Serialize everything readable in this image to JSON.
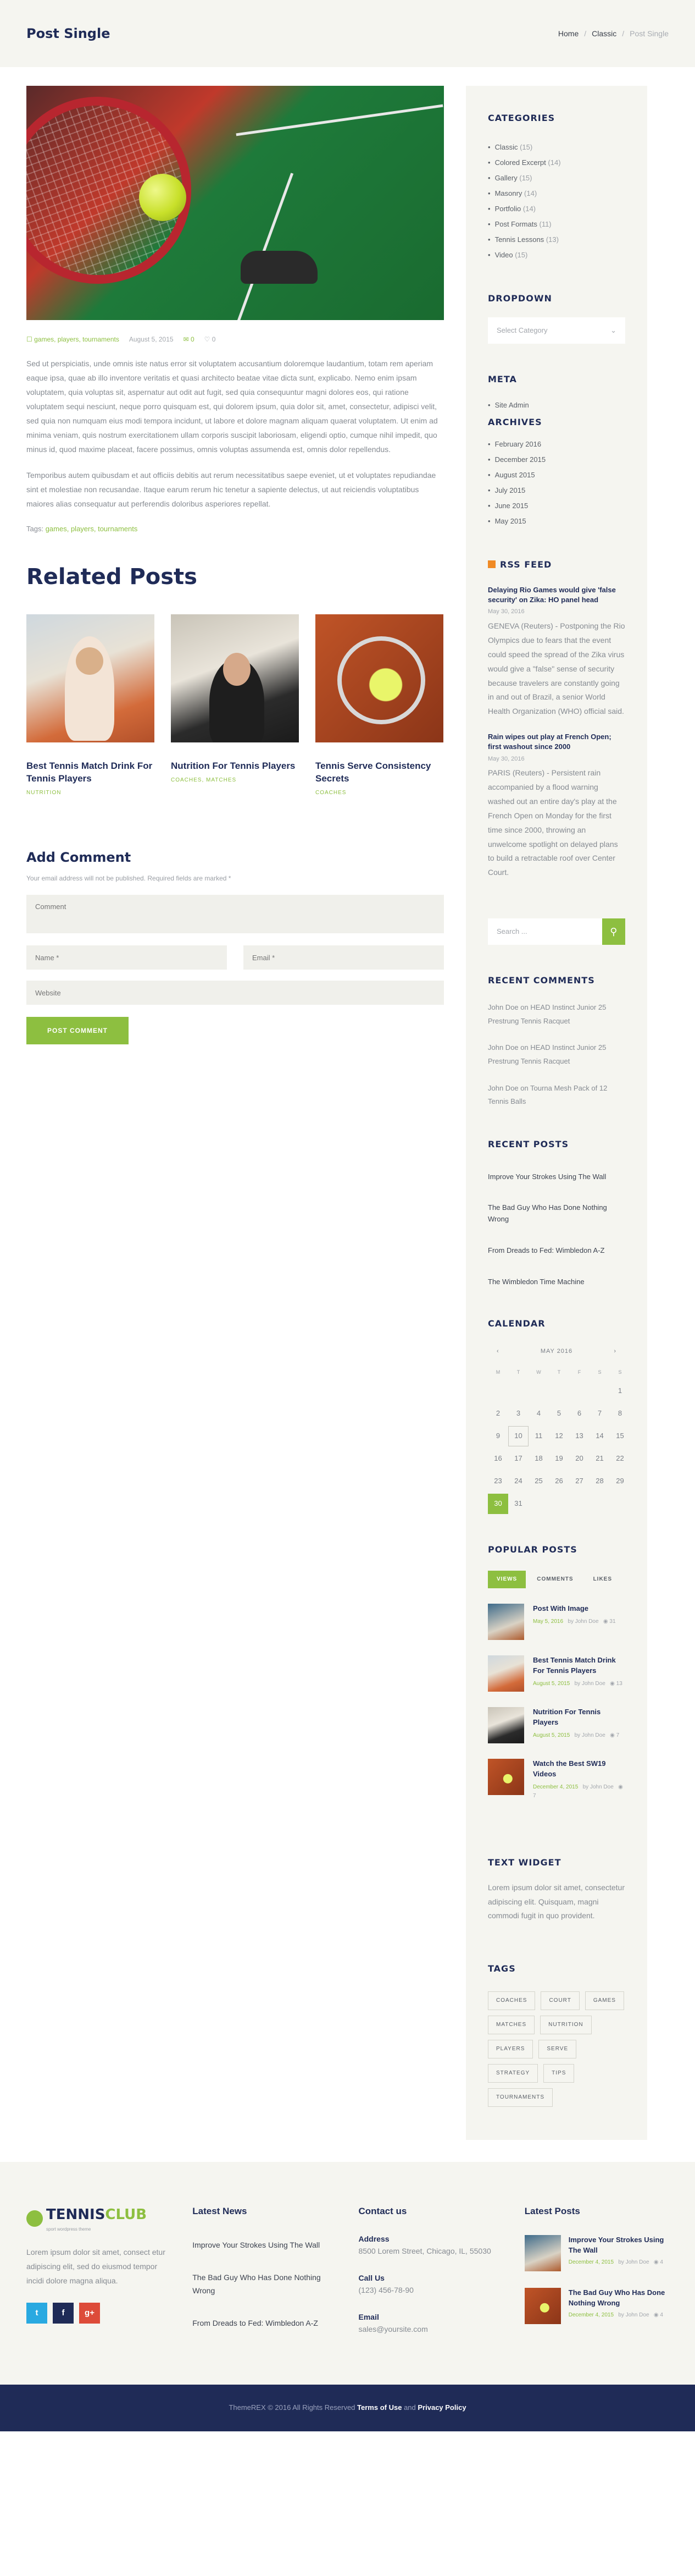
{
  "header": {
    "title": "Post Single",
    "breadcrumb": [
      "Home",
      "Classic",
      "Post Single"
    ]
  },
  "post": {
    "categories": "games, players, tournaments",
    "date": "August 5, 2015",
    "comments_count": "0",
    "likes_count": "0",
    "paragraph1": "Sed ut perspiciatis, unde omnis iste natus error sit voluptatem accusantium doloremque laudantium, totam rem aperiam eaque ipsa, quae ab illo inventore veritatis et quasi architecto beatae vitae dicta sunt, explicabo. Nemo enim ipsam voluptatem, quia voluptas sit, aspernatur aut odit aut fugit, sed quia consequuntur magni dolores eos, qui ratione voluptatem sequi nesciunt, neque porro quisquam est, qui dolorem ipsum, quia dolor sit, amet, consectetur, adipisci velit, sed quia non numquam eius modi tempora incidunt, ut labore et dolore magnam aliquam quaerat voluptatem. Ut enim ad minima veniam, quis nostrum exercitationem ullam corporis suscipit laboriosam, eligendi optio, cumque nihil impedit, quo minus id, quod maxime placeat, facere possimus, omnis voluptas assumenda est, omnis dolor repellendus.",
    "paragraph2": "Temporibus autem quibusdam et aut officiis debitis aut rerum necessitatibus saepe eveniet, ut et voluptates repudiandae sint et molestiae non recusandae. Itaque earum rerum hic tenetur a sapiente delectus, ut aut reiciendis voluptatibus maiores alias consequatur aut perferendis doloribus asperiores repellat.",
    "tags_label": "Tags:",
    "tags": "games, players, tournaments"
  },
  "related": {
    "heading": "Related Posts",
    "items": [
      {
        "title": "Best Tennis Match Drink For Tennis Players",
        "cats": "NUTRITION"
      },
      {
        "title": "Nutrition For Tennis Players",
        "cats": "COACHES, MATCHES"
      },
      {
        "title": "Tennis Serve Consistency Secrets",
        "cats": "COACHES"
      }
    ]
  },
  "comment_form": {
    "heading": "Add Comment",
    "note": "Your email address will not be published. Required fields are marked *",
    "comment_placeholder": "Comment",
    "name_placeholder": "Name *",
    "email_placeholder": "Email *",
    "website_placeholder": "Website",
    "submit_label": "POST COMMENT"
  },
  "sidebar": {
    "categories_title": "CATEGORIES",
    "categories": [
      {
        "label": "Classic",
        "count": "(15)"
      },
      {
        "label": "Colored Excerpt",
        "count": "(14)"
      },
      {
        "label": "Gallery",
        "count": "(15)"
      },
      {
        "label": "Masonry",
        "count": "(14)"
      },
      {
        "label": "Portfolio",
        "count": "(14)"
      },
      {
        "label": "Post Formats",
        "count": "(11)"
      },
      {
        "label": "Tennis Lessons",
        "count": "(13)"
      },
      {
        "label": "Video",
        "count": "(15)"
      }
    ],
    "dropdown_title": "DROPDOWN",
    "dropdown_value": "Select Category",
    "meta_title": "META",
    "meta_link": "Site Admin",
    "archives_title": "ARCHIVES",
    "archives": [
      "February 2016",
      "December 2015",
      "August 2015",
      "July 2015",
      "June 2015",
      "May 2015"
    ],
    "rss_title": "RSS FEED",
    "rss": [
      {
        "title": "Delaying Rio Games would give 'false security' on Zika: HO panel head",
        "date": "May 30, 2016",
        "body": "GENEVA (Reuters) - Postponing the Rio Olympics due to fears that the event could speed the spread of the Zika virus would give a \"false\" sense of security because travelers are constantly going in and out of Brazil, a senior World Health Organization (WHO) official said."
      },
      {
        "title": "Rain wipes out play at French Open; first washout since 2000",
        "date": "May 30, 2016",
        "body": "PARIS (Reuters) - Persistent rain accompanied by a flood warning washed out an entire day's play at the French Open on Monday for the first time since 2000, throwing an unwelcome spotlight on delayed plans to build a retractable roof over Center Court."
      }
    ],
    "search_placeholder": "Search ...",
    "recent_comments_title": "RECENT COMMENTS",
    "recent_comments": [
      {
        "author": "John Doe",
        "on": "on",
        "post": "HEAD Instinct Junior 25 Prestrung Tennis Racquet"
      },
      {
        "author": "John Doe",
        "on": "on",
        "post": "HEAD Instinct Junior 25 Prestrung Tennis Racquet"
      },
      {
        "author": "John Doe",
        "on": "on",
        "post": "Tourna Mesh Pack of 12 Tennis Balls"
      }
    ],
    "recent_posts_title": "RECENT POSTS",
    "recent_posts": [
      "Improve Your Strokes Using The Wall",
      "The Bad Guy Who Has Done Nothing Wrong",
      "From Dreads to Fed: Wimbledon A-Z",
      "The Wimbledon Time Machine"
    ],
    "calendar_title": "CALENDAR",
    "calendar": {
      "month": "MAY 2016",
      "prev": "‹",
      "next": "›",
      "dow": [
        "M",
        "T",
        "W",
        "T",
        "F",
        "S",
        "S"
      ],
      "today": "10",
      "selected": "30"
    },
    "popular_title": "POPULAR POSTS",
    "popular_tabs": [
      "VIEWS",
      "COMMENTS",
      "LIKES"
    ],
    "popular": [
      {
        "title": "Post With Image",
        "date": "May 5, 2016",
        "author": "by John Doe",
        "views": "31"
      },
      {
        "title": "Best Tennis Match Drink For Tennis Players",
        "date": "August 5, 2015",
        "author": "by John Doe",
        "views": "13"
      },
      {
        "title": "Nutrition For Tennis Players",
        "date": "August 5, 2015",
        "author": "by John Doe",
        "views": "7"
      },
      {
        "title": "Watch the Best SW19 Videos",
        "date": "December 4, 2015",
        "author": "by John Doe",
        "views": "7"
      }
    ],
    "text_widget_title": "TEXT WIDGET",
    "text_widget_body": "Lorem ipsum dolor sit amet, consectetur adipiscing elit. Quisquam, magni commodi fugit in quo provident.",
    "tags_title": "TAGS",
    "tags": [
      "COACHES",
      "COURT",
      "GAMES",
      "MATCHES",
      "NUTRITION",
      "PLAYERS",
      "SERVE",
      "STRATEGY",
      "TIPS",
      "TOURNAMENTS"
    ]
  },
  "footer": {
    "logo_main": "TENNIS",
    "logo_accent": "CLUB",
    "logo_tagline": "sport wordpress theme",
    "about": "Lorem ipsum dolor sit amet, consect etur adipiscing elit, sed do eiusmod tempor incidi dolore magna aliqua.",
    "social": [
      "t",
      "f",
      "g+"
    ],
    "news_title": "Latest News",
    "news": [
      "Improve Your Strokes Using The Wall",
      "The Bad Guy Who Has Done Nothing Wrong",
      "From Dreads to Fed: Wimbledon A-Z"
    ],
    "contact_title": "Contact us",
    "address_label": "Address",
    "address": "8500 Lorem Street, Chicago, IL, 55030",
    "call_label": "Call Us",
    "phone": "(123) 456-78-90",
    "email_label": "Email",
    "email": "sales@yoursite.com",
    "posts_title": "Latest Posts",
    "posts": [
      {
        "title": "Improve Your Strokes Using The Wall",
        "date": "December 4, 2015",
        "author": "by John Doe",
        "views": "4"
      },
      {
        "title": "The Bad Guy Who Has Done Nothing Wrong",
        "date": "December 4, 2015",
        "author": "by John Doe",
        "views": "4"
      }
    ]
  },
  "bottombar": {
    "copyright": "ThemeREX © 2016 All Rights Reserved",
    "terms": "Terms of Use",
    "and": "and",
    "privacy": "Privacy Policy"
  },
  "colors": {
    "accent": "#8dbf40",
    "navy": "#1f2b57",
    "panel": "#f5f5f0"
  }
}
